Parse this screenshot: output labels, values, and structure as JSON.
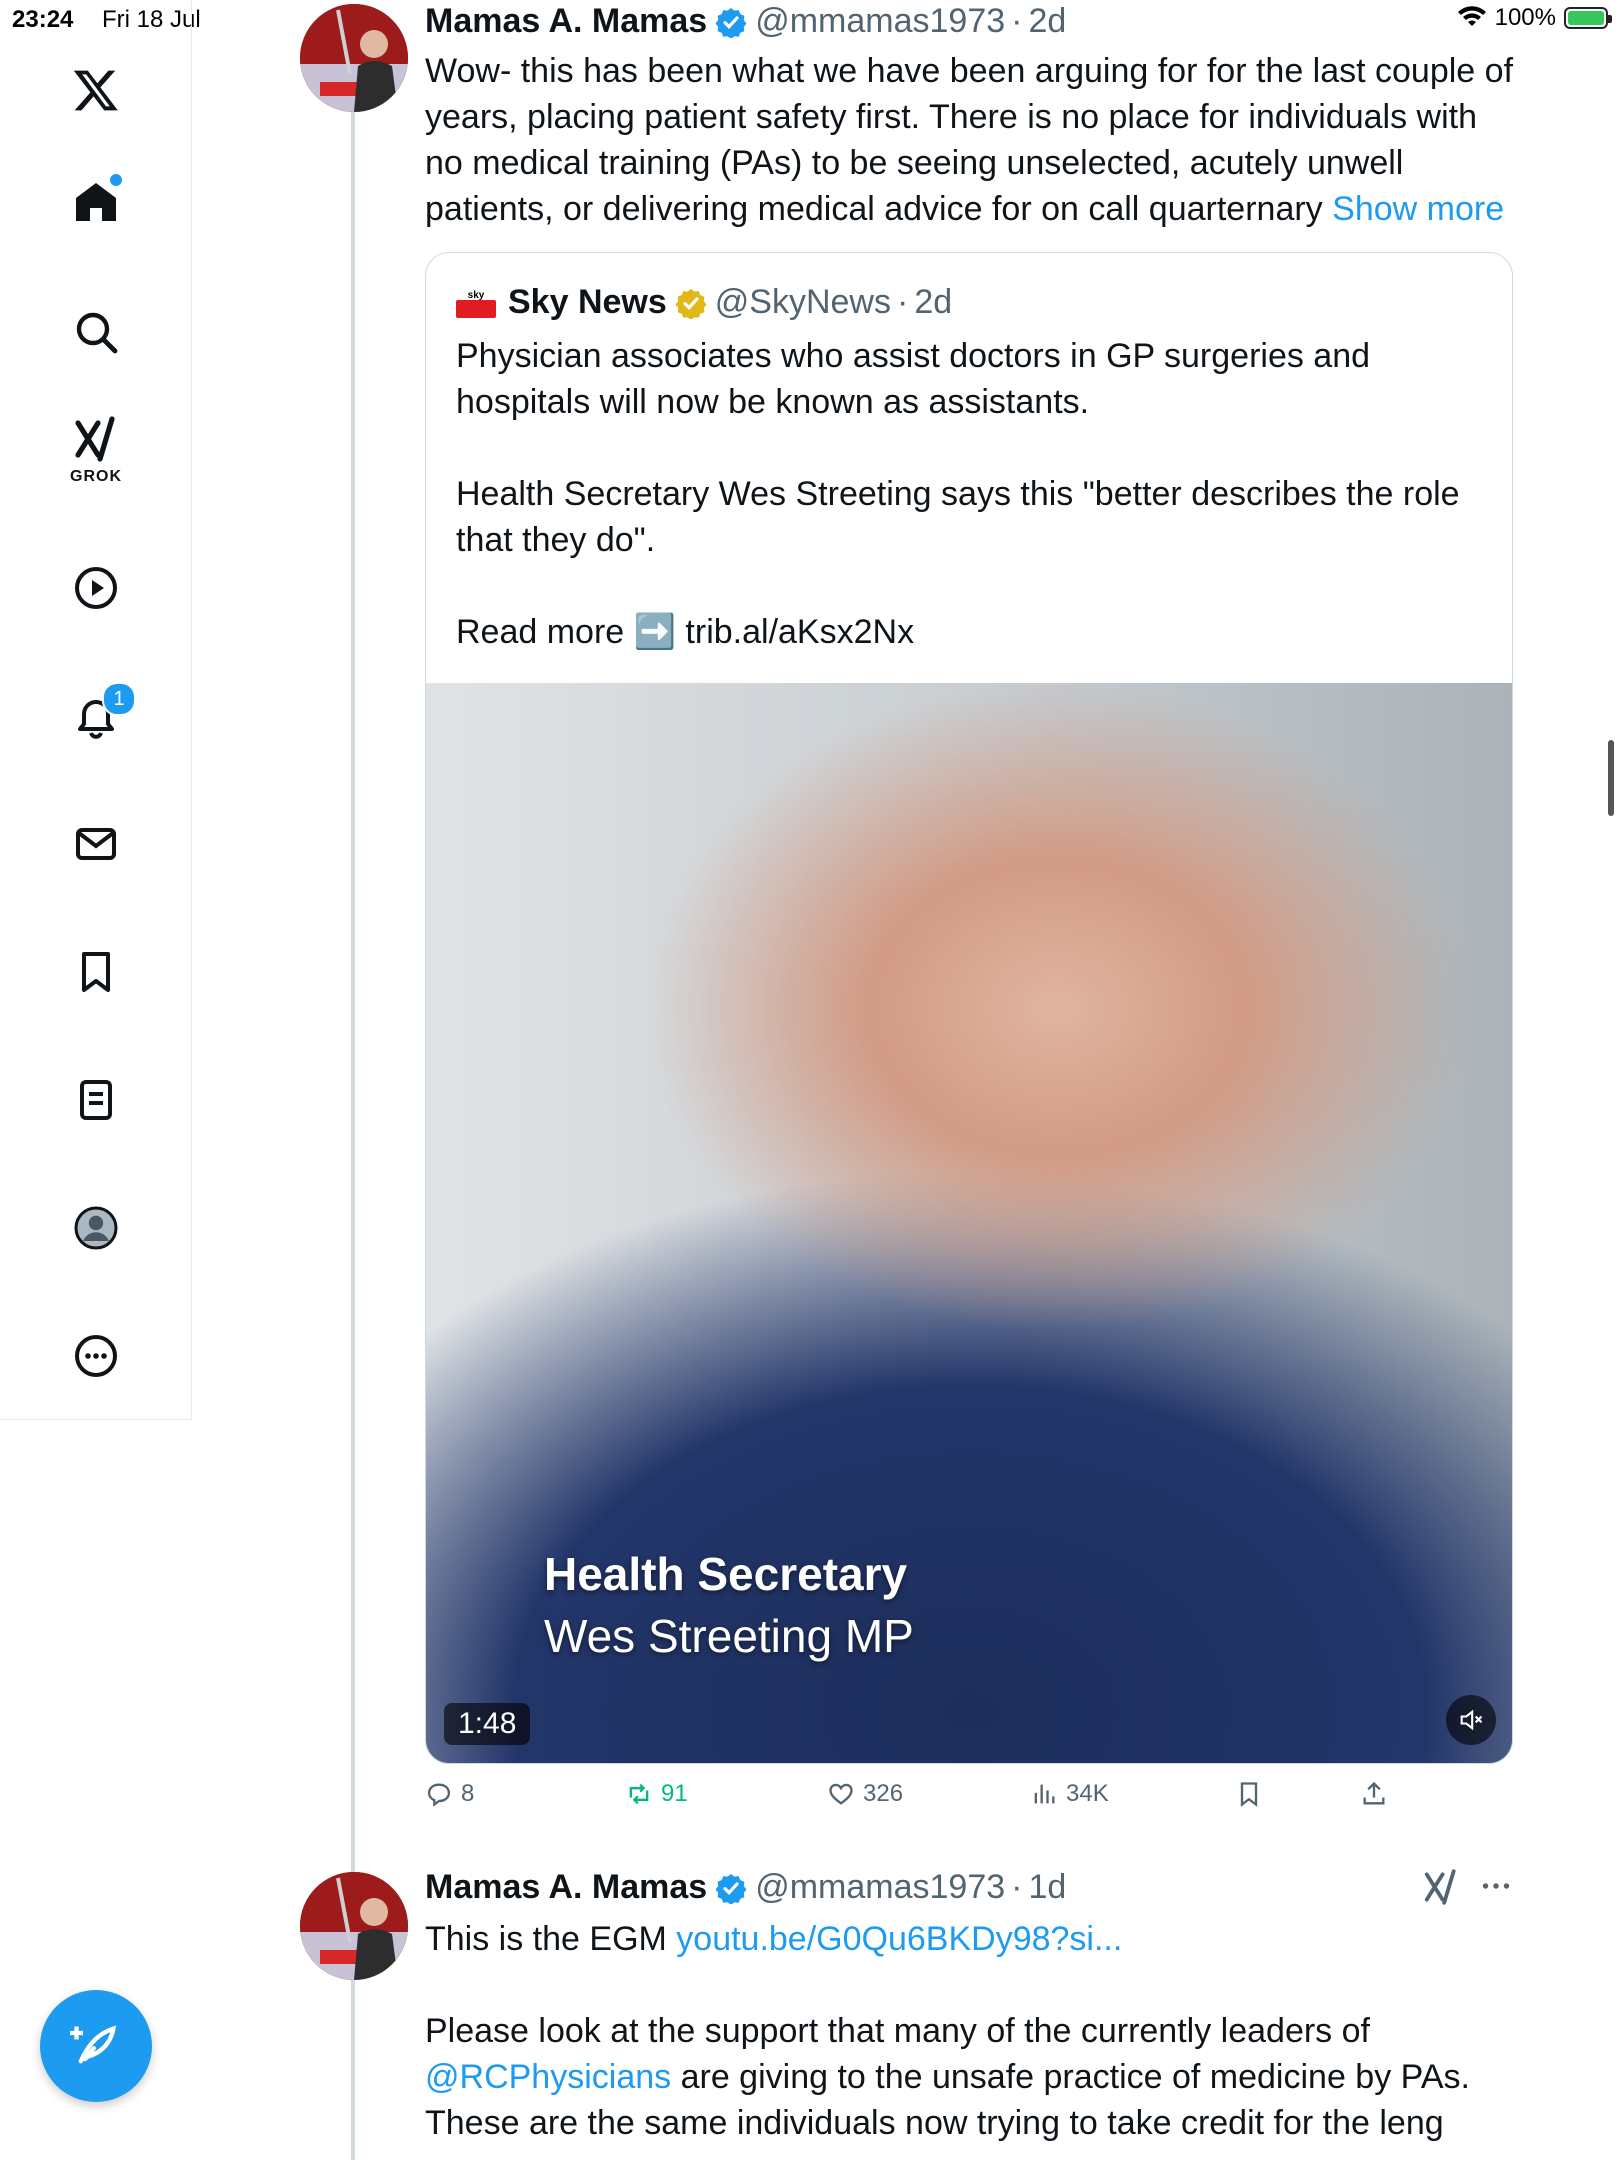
{
  "status_bar": {
    "time": "23:24",
    "date": "Fri 18 Jul",
    "battery": "100%"
  },
  "sidebar": {
    "grok_label": "GROK",
    "notifications_badge": "1"
  },
  "tweet1": {
    "name": "Mamas A. Mamas",
    "handle": "@mmamas1973",
    "sep": "·",
    "time": "2d",
    "text": "Wow- this has been what we have been arguing for for the last couple of years, placing patient safety first. There is no place for individuals with no medical training (PAs) to be seeing unselected, acutely unwell patients, or delivering medical advice for on call quarternary ",
    "show_more": "Show more",
    "quote": {
      "name": "Sky News",
      "handle": "@SkyNews",
      "sep": "·",
      "time": "2d",
      "para1": "Physician associates who assist doctors in GP surgeries and hospitals will now be known as assistants.",
      "para2": "Health Secretary Wes Streeting says this \"better describes the role that they do\".",
      "para3_prefix": "Read more ",
      "para3_emoji": "➡️",
      "para3_link": " trib.al/aKsx2Nx",
      "video": {
        "caption_line1": "Health Secretary",
        "caption_line2": "Wes Streeting MP",
        "duration": "1:48"
      }
    },
    "actions": {
      "replies": "8",
      "reposts": "91",
      "likes": "326",
      "views": "34K"
    }
  },
  "tweet2": {
    "name": "Mamas A. Mamas",
    "handle": "@mmamas1973",
    "sep": "·",
    "time": "1d",
    "line1_prefix": "This is the EGM ",
    "line1_link": "youtu.be/G0Qu6BKDy98?si...",
    "para2_prefix": "Please look at the support that many of the currently leaders of ",
    "para2_mention": "@RCPhysicians",
    "para2_suffix": " are giving to the unsafe practice of medicine by PAs. These are the same individuals now trying to take credit for the leng"
  },
  "colors": {
    "accent": "#1d9bf0",
    "repost": "#00ba7c",
    "muted": "#536471"
  }
}
